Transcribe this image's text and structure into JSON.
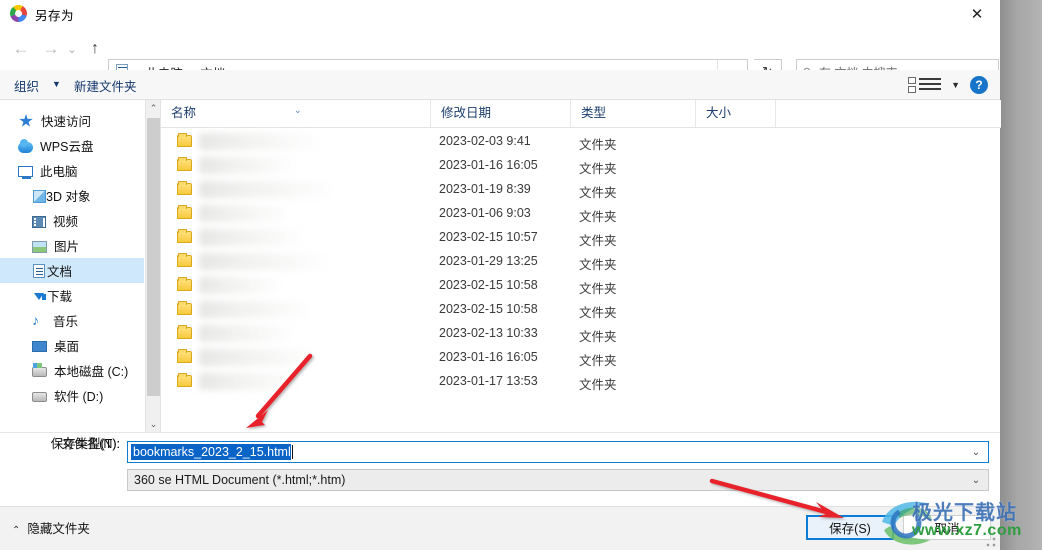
{
  "window": {
    "title": "另存为",
    "app_icon": "browser-logo-icon",
    "close_label": "✕"
  },
  "nav": {
    "back_icon": "arrow-left-icon",
    "forward_icon": "arrow-right-icon",
    "recent_icon": "chevron-down-icon",
    "up_icon": "arrow-up-icon",
    "address_icon": "documents-folder-icon",
    "breadcrumbs": [
      "此电脑",
      "文档"
    ],
    "separator": "›",
    "dropdown_icon": "chevron-down-icon",
    "refresh_icon": "↻",
    "search_icon": "search-icon",
    "search_placeholder": "在 文档 中搜索"
  },
  "toolbar": {
    "organize_label": "组织",
    "organize_caret": "▼",
    "new_folder_label": "新建文件夹",
    "view_icon": "list-view-icon",
    "view_caret": "▼",
    "help_label": "?"
  },
  "sidebar": {
    "items": [
      {
        "label": "快速访问",
        "icon": "star-quick-access-icon",
        "indent": false,
        "selected": false
      },
      {
        "label": "WPS云盘",
        "icon": "cloud-icon",
        "indent": false,
        "selected": false
      },
      {
        "label": "此电脑",
        "icon": "this-pc-icon",
        "indent": false,
        "selected": false
      },
      {
        "label": "3D 对象",
        "icon": "3d-objects-icon",
        "indent": true,
        "selected": false
      },
      {
        "label": "视频",
        "icon": "videos-icon",
        "indent": true,
        "selected": false
      },
      {
        "label": "图片",
        "icon": "pictures-icon",
        "indent": true,
        "selected": false
      },
      {
        "label": "文档",
        "icon": "documents-icon",
        "indent": true,
        "selected": true
      },
      {
        "label": "下载",
        "icon": "downloads-icon",
        "indent": true,
        "selected": false
      },
      {
        "label": "音乐",
        "icon": "music-icon",
        "indent": true,
        "selected": false
      },
      {
        "label": "桌面",
        "icon": "desktop-icon",
        "indent": true,
        "selected": false
      },
      {
        "label": "本地磁盘 (C:)",
        "icon": "local-disk-c-icon",
        "indent": true,
        "selected": false
      },
      {
        "label": "软件 (D:)",
        "icon": "disk-d-icon",
        "indent": true,
        "selected": false
      }
    ],
    "scroll_up_icon": "⌃",
    "scroll_down_icon": "⌄"
  },
  "file_list": {
    "columns": [
      "名称",
      "修改日期",
      "类型",
      "大小"
    ],
    "sort_indicator": "⌄",
    "rows": [
      {
        "name": "",
        "date": "2023-02-03 9:41",
        "type": "文件夹",
        "size": ""
      },
      {
        "name": "",
        "date": "2023-01-16 16:05",
        "type": "文件夹",
        "size": ""
      },
      {
        "name": "",
        "date": "2023-01-19 8:39",
        "type": "文件夹",
        "size": ""
      },
      {
        "name": "",
        "date": "2023-01-06 9:03",
        "type": "文件夹",
        "size": ""
      },
      {
        "name": "",
        "date": "2023-02-15 10:57",
        "type": "文件夹",
        "size": ""
      },
      {
        "name": "",
        "date": "2023-01-29 13:25",
        "type": "文件夹",
        "size": ""
      },
      {
        "name": "",
        "date": "2023-02-15 10:58",
        "type": "文件夹",
        "size": ""
      },
      {
        "name": "",
        "date": "2023-02-15 10:58",
        "type": "文件夹",
        "size": ""
      },
      {
        "name": "",
        "date": "2023-02-13 10:33",
        "type": "文件夹",
        "size": ""
      },
      {
        "name": "",
        "date": "2023-01-16 16:05",
        "type": "文件夹",
        "size": ""
      },
      {
        "name": "",
        "date": "2023-01-17 13:53",
        "type": "文件夹",
        "size": ""
      }
    ]
  },
  "form": {
    "filename_label": "文件名(N):",
    "filename_value": "bookmarks_2023_2_15.html",
    "filetype_label": "保存类型(T):",
    "filetype_value": "360 se HTML Document (*.html;*.htm)",
    "dropdown_icon": "chevron-down-icon"
  },
  "footer": {
    "hide_folders_caret": "⌃",
    "hide_folders_label": "隐藏文件夹",
    "save_label": "保存(S)",
    "cancel_label": "取消"
  },
  "annotations": {
    "arrow_color": "#e8232a",
    "arrow_1_target": "filename-field",
    "arrow_2_target": "save-button"
  },
  "watermark": {
    "site_name": "极光下载站",
    "url": "www.xz7.com"
  }
}
